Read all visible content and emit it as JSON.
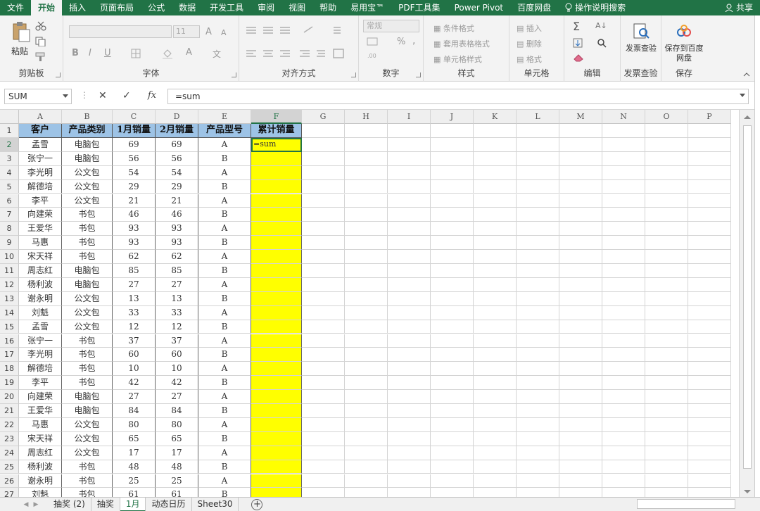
{
  "ribbon_tabs": [
    "文件",
    "开始",
    "插入",
    "页面布局",
    "公式",
    "数据",
    "开发工具",
    "审阅",
    "视图",
    "帮助",
    "易用宝™",
    "PDF工具集",
    "Power Pivot",
    "百度网盘"
  ],
  "active_tab": "开始",
  "search_label": "操作说明搜索",
  "share_label": "共享",
  "groups": {
    "clipboard": "剪贴板",
    "font": "字体",
    "align": "对齐方式",
    "number": "数字",
    "styles": "样式",
    "cells": "单元格",
    "edit": "编辑",
    "invoice": "发票查验",
    "save": "保存"
  },
  "clipboard": {
    "paste": "粘贴"
  },
  "font": {
    "size": "11",
    "bold": "B",
    "italic": "I",
    "underline": "U",
    "grow": "A",
    "shrink": "A",
    "color_a": "A",
    "wen": "文"
  },
  "number": {
    "format": "常规",
    "percent": "%",
    "comma": ","
  },
  "styles": {
    "cond": "条件格式",
    "table": "套用表格格式",
    "cell": "单元格样式"
  },
  "cells": {
    "insert": "插入",
    "delete": "删除",
    "format": "格式"
  },
  "invoice_btn": "发票查验",
  "save_btn": "保存到百度网盘",
  "name_box": "SUM",
  "fx_label": "fx",
  "formula": "=sum",
  "columns": [
    "A",
    "B",
    "C",
    "D",
    "E",
    "F",
    "G",
    "H",
    "I",
    "J",
    "K",
    "L",
    "M",
    "N",
    "O",
    "P"
  ],
  "header": [
    "客户",
    "产品类别",
    "1月销量",
    "2月销量",
    "产品型号",
    "累计销量"
  ],
  "rows": [
    [
      "孟雪",
      "电脑包",
      "69",
      "69",
      "A"
    ],
    [
      "张宁一",
      "电脑包",
      "56",
      "56",
      "B"
    ],
    [
      "李光明",
      "公文包",
      "54",
      "54",
      "A"
    ],
    [
      "解德培",
      "公文包",
      "29",
      "29",
      "B"
    ],
    [
      "李平",
      "公文包",
      "21",
      "21",
      "A"
    ],
    [
      "向建荣",
      "书包",
      "46",
      "46",
      "B"
    ],
    [
      "王爱华",
      "书包",
      "93",
      "93",
      "A"
    ],
    [
      "马惠",
      "书包",
      "93",
      "93",
      "B"
    ],
    [
      "宋天祥",
      "书包",
      "62",
      "62",
      "A"
    ],
    [
      "周志红",
      "电脑包",
      "85",
      "85",
      "B"
    ],
    [
      "杨利波",
      "电脑包",
      "27",
      "27",
      "A"
    ],
    [
      "谢永明",
      "公文包",
      "13",
      "13",
      "B"
    ],
    [
      "刘魁",
      "公文包",
      "33",
      "33",
      "A"
    ],
    [
      "孟雪",
      "公文包",
      "12",
      "12",
      "B"
    ],
    [
      "张宁一",
      "书包",
      "37",
      "37",
      "A"
    ],
    [
      "李光明",
      "书包",
      "60",
      "60",
      "B"
    ],
    [
      "解德培",
      "书包",
      "10",
      "10",
      "A"
    ],
    [
      "李平",
      "书包",
      "42",
      "42",
      "B"
    ],
    [
      "向建荣",
      "电脑包",
      "27",
      "27",
      "A"
    ],
    [
      "王爱华",
      "电脑包",
      "84",
      "84",
      "B"
    ],
    [
      "马惠",
      "公文包",
      "80",
      "80",
      "A"
    ],
    [
      "宋天祥",
      "公文包",
      "65",
      "65",
      "B"
    ],
    [
      "周志红",
      "公文包",
      "17",
      "17",
      "A"
    ],
    [
      "杨利波",
      "书包",
      "48",
      "48",
      "B"
    ],
    [
      "谢永明",
      "书包",
      "25",
      "25",
      "A"
    ],
    [
      "刘魁",
      "书包",
      "61",
      "61",
      "B"
    ]
  ],
  "active_cell_value": "=sum",
  "sheets": [
    "抽奖 (2)",
    "抽奖",
    "1月",
    "动态日历",
    "Sheet30"
  ],
  "active_sheet": "1月",
  "colors": {
    "accent": "#217346",
    "header_fill": "#9dc3e6",
    "highlight": "#ffff00"
  }
}
